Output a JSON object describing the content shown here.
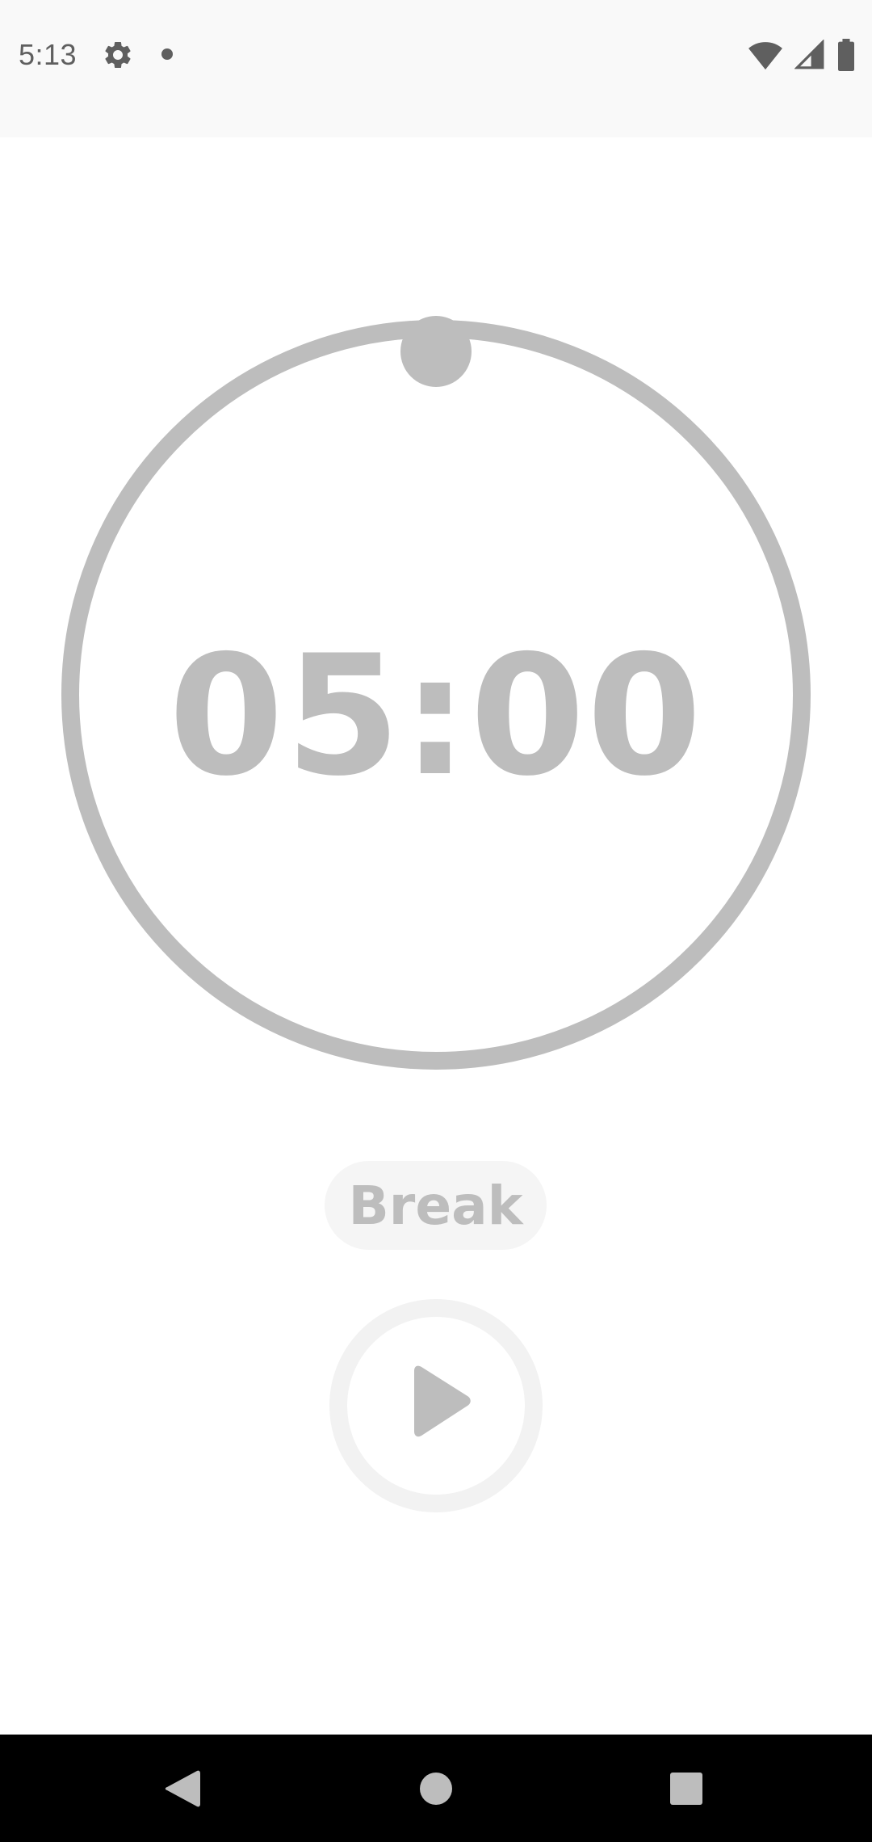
{
  "status_bar": {
    "time": "5:13",
    "icons": [
      "gear-icon",
      "notification-dot-icon",
      "wifi-icon",
      "cellular-signal-icon",
      "battery-icon"
    ]
  },
  "timer": {
    "display": "05:00",
    "mode_label": "Break",
    "progress": 0
  },
  "controls": {
    "play_icon": "play-icon"
  },
  "nav_bar": {
    "buttons": [
      "back-icon",
      "home-icon",
      "recents-icon"
    ]
  },
  "colors": {
    "dial": "#bdbdbd",
    "chip_bg": "#f5f5f5",
    "play_ring": "#f2f2f2",
    "status_bg": "#f9f9f9",
    "icon_dark": "#5f5f5f"
  }
}
